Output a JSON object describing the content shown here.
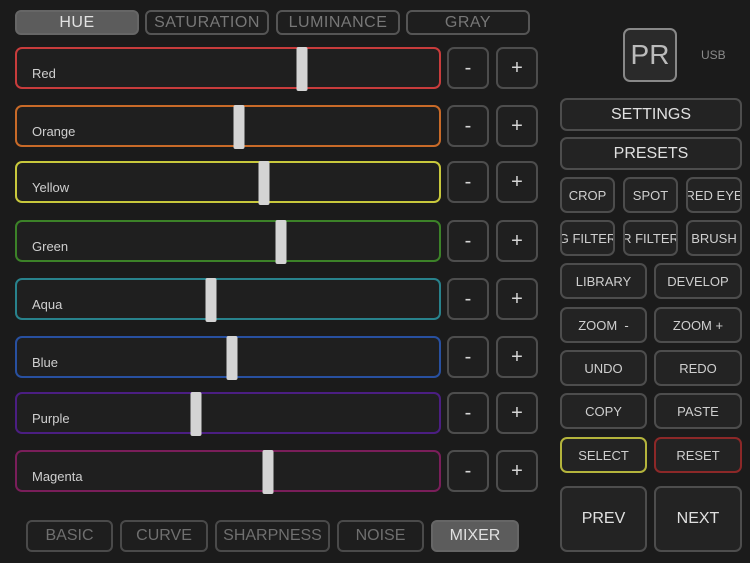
{
  "mode_tabs": [
    {
      "label": "HUE",
      "active": true
    },
    {
      "label": "SATURATION",
      "active": false
    },
    {
      "label": "LUMINANCE",
      "active": false
    },
    {
      "label": "GRAY",
      "active": false
    }
  ],
  "channels": [
    {
      "label": "Red",
      "color": "#c83c3c",
      "value": 0.67
    },
    {
      "label": "Orange",
      "color": "#c86a28",
      "value": 0.52
    },
    {
      "label": "Yellow",
      "color": "#c8c83c",
      "value": 0.58
    },
    {
      "label": "Green",
      "color": "#3c8228",
      "value": 0.62
    },
    {
      "label": "Aqua",
      "color": "#28828c",
      "value": 0.455
    },
    {
      "label": "Blue",
      "color": "#2850a0",
      "value": 0.505
    },
    {
      "label": "Purple",
      "color": "#4b1e82",
      "value": 0.42
    },
    {
      "label": "Magenta",
      "color": "#7a1e5a",
      "value": 0.59
    }
  ],
  "stepper": {
    "minus": "-",
    "plus": "+"
  },
  "device": {
    "logo": "PR",
    "connection": "USB"
  },
  "right_panel": {
    "settings": "SETTINGS",
    "presets": "PRESETS",
    "crop": "CROP",
    "spot": "SPOT",
    "red_eye": "RED EYE",
    "g_filter": "G FILTER",
    "r_filter": "R FILTER",
    "brush": "BRUSH",
    "library": "LIBRARY",
    "develop": "DEVELOP",
    "zoom_out": "ZOOM  -",
    "zoom_in": "ZOOM +",
    "undo": "UNDO",
    "redo": "REDO",
    "copy": "COPY",
    "paste": "PASTE",
    "select": "SELECT",
    "reset": "RESET",
    "prev": "PREV",
    "next": "NEXT"
  },
  "colors": {
    "select_border": "#b4b43c",
    "reset_border": "#8c2828"
  },
  "bottom_tabs": [
    {
      "label": "BASIC",
      "active": false
    },
    {
      "label": "CURVE",
      "active": false
    },
    {
      "label": "SHARPNESS",
      "active": false
    },
    {
      "label": "NOISE",
      "active": false
    },
    {
      "label": "MIXER",
      "active": true
    }
  ]
}
